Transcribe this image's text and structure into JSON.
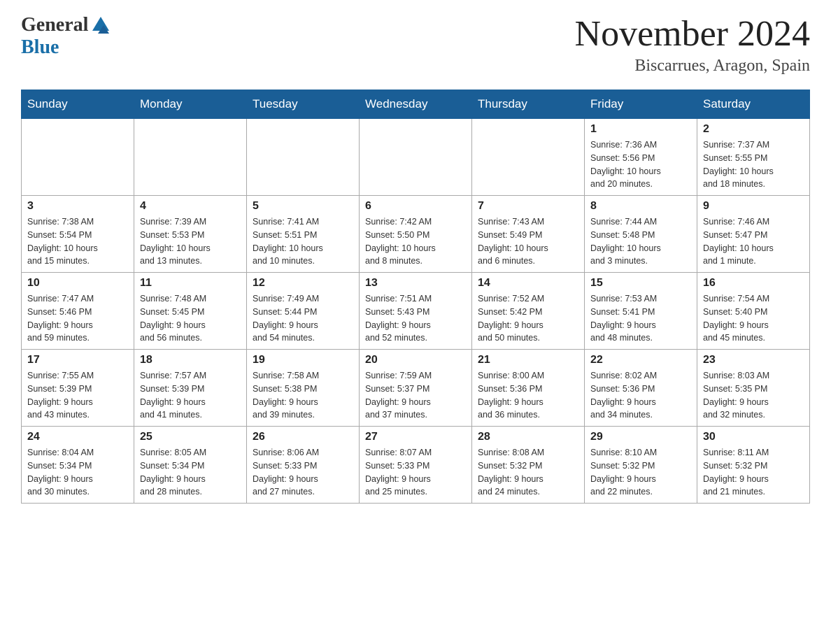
{
  "header": {
    "logo_general": "General",
    "logo_blue": "Blue",
    "month_title": "November 2024",
    "location": "Biscarrues, Aragon, Spain"
  },
  "days_of_week": [
    "Sunday",
    "Monday",
    "Tuesday",
    "Wednesday",
    "Thursday",
    "Friday",
    "Saturday"
  ],
  "weeks": [
    [
      {
        "day": "",
        "info": ""
      },
      {
        "day": "",
        "info": ""
      },
      {
        "day": "",
        "info": ""
      },
      {
        "day": "",
        "info": ""
      },
      {
        "day": "",
        "info": ""
      },
      {
        "day": "1",
        "info": "Sunrise: 7:36 AM\nSunset: 5:56 PM\nDaylight: 10 hours\nand 20 minutes."
      },
      {
        "day": "2",
        "info": "Sunrise: 7:37 AM\nSunset: 5:55 PM\nDaylight: 10 hours\nand 18 minutes."
      }
    ],
    [
      {
        "day": "3",
        "info": "Sunrise: 7:38 AM\nSunset: 5:54 PM\nDaylight: 10 hours\nand 15 minutes."
      },
      {
        "day": "4",
        "info": "Sunrise: 7:39 AM\nSunset: 5:53 PM\nDaylight: 10 hours\nand 13 minutes."
      },
      {
        "day": "5",
        "info": "Sunrise: 7:41 AM\nSunset: 5:51 PM\nDaylight: 10 hours\nand 10 minutes."
      },
      {
        "day": "6",
        "info": "Sunrise: 7:42 AM\nSunset: 5:50 PM\nDaylight: 10 hours\nand 8 minutes."
      },
      {
        "day": "7",
        "info": "Sunrise: 7:43 AM\nSunset: 5:49 PM\nDaylight: 10 hours\nand 6 minutes."
      },
      {
        "day": "8",
        "info": "Sunrise: 7:44 AM\nSunset: 5:48 PM\nDaylight: 10 hours\nand 3 minutes."
      },
      {
        "day": "9",
        "info": "Sunrise: 7:46 AM\nSunset: 5:47 PM\nDaylight: 10 hours\nand 1 minute."
      }
    ],
    [
      {
        "day": "10",
        "info": "Sunrise: 7:47 AM\nSunset: 5:46 PM\nDaylight: 9 hours\nand 59 minutes."
      },
      {
        "day": "11",
        "info": "Sunrise: 7:48 AM\nSunset: 5:45 PM\nDaylight: 9 hours\nand 56 minutes."
      },
      {
        "day": "12",
        "info": "Sunrise: 7:49 AM\nSunset: 5:44 PM\nDaylight: 9 hours\nand 54 minutes."
      },
      {
        "day": "13",
        "info": "Sunrise: 7:51 AM\nSunset: 5:43 PM\nDaylight: 9 hours\nand 52 minutes."
      },
      {
        "day": "14",
        "info": "Sunrise: 7:52 AM\nSunset: 5:42 PM\nDaylight: 9 hours\nand 50 minutes."
      },
      {
        "day": "15",
        "info": "Sunrise: 7:53 AM\nSunset: 5:41 PM\nDaylight: 9 hours\nand 48 minutes."
      },
      {
        "day": "16",
        "info": "Sunrise: 7:54 AM\nSunset: 5:40 PM\nDaylight: 9 hours\nand 45 minutes."
      }
    ],
    [
      {
        "day": "17",
        "info": "Sunrise: 7:55 AM\nSunset: 5:39 PM\nDaylight: 9 hours\nand 43 minutes."
      },
      {
        "day": "18",
        "info": "Sunrise: 7:57 AM\nSunset: 5:39 PM\nDaylight: 9 hours\nand 41 minutes."
      },
      {
        "day": "19",
        "info": "Sunrise: 7:58 AM\nSunset: 5:38 PM\nDaylight: 9 hours\nand 39 minutes."
      },
      {
        "day": "20",
        "info": "Sunrise: 7:59 AM\nSunset: 5:37 PM\nDaylight: 9 hours\nand 37 minutes."
      },
      {
        "day": "21",
        "info": "Sunrise: 8:00 AM\nSunset: 5:36 PM\nDaylight: 9 hours\nand 36 minutes."
      },
      {
        "day": "22",
        "info": "Sunrise: 8:02 AM\nSunset: 5:36 PM\nDaylight: 9 hours\nand 34 minutes."
      },
      {
        "day": "23",
        "info": "Sunrise: 8:03 AM\nSunset: 5:35 PM\nDaylight: 9 hours\nand 32 minutes."
      }
    ],
    [
      {
        "day": "24",
        "info": "Sunrise: 8:04 AM\nSunset: 5:34 PM\nDaylight: 9 hours\nand 30 minutes."
      },
      {
        "day": "25",
        "info": "Sunrise: 8:05 AM\nSunset: 5:34 PM\nDaylight: 9 hours\nand 28 minutes."
      },
      {
        "day": "26",
        "info": "Sunrise: 8:06 AM\nSunset: 5:33 PM\nDaylight: 9 hours\nand 27 minutes."
      },
      {
        "day": "27",
        "info": "Sunrise: 8:07 AM\nSunset: 5:33 PM\nDaylight: 9 hours\nand 25 minutes."
      },
      {
        "day": "28",
        "info": "Sunrise: 8:08 AM\nSunset: 5:32 PM\nDaylight: 9 hours\nand 24 minutes."
      },
      {
        "day": "29",
        "info": "Sunrise: 8:10 AM\nSunset: 5:32 PM\nDaylight: 9 hours\nand 22 minutes."
      },
      {
        "day": "30",
        "info": "Sunrise: 8:11 AM\nSunset: 5:32 PM\nDaylight: 9 hours\nand 21 minutes."
      }
    ]
  ]
}
